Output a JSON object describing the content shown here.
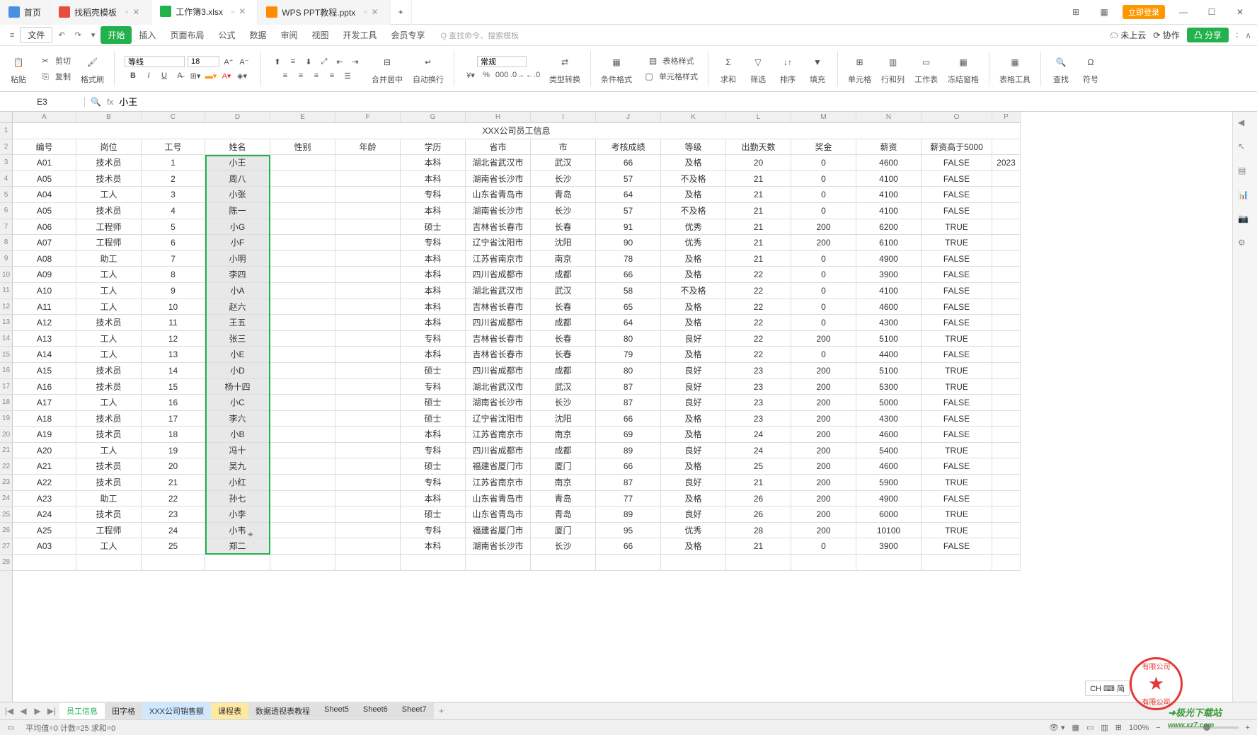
{
  "titlebar": {
    "tabs": [
      {
        "icon": "home",
        "label": "首页",
        "color": "#4a90e2"
      },
      {
        "icon": "doc",
        "label": "找稻壳模板",
        "color": "#e74c3c"
      },
      {
        "icon": "xls",
        "label": "工作簿3.xlsx",
        "color": "#22b14c",
        "active": true
      },
      {
        "icon": "ppt",
        "label": "WPS PPT教程.pptx",
        "color": "#ff8c00"
      }
    ],
    "login": "立即登录",
    "winbtns": [
      "—",
      "☐",
      "✕"
    ]
  },
  "menubar": {
    "file": "文件",
    "items": [
      "开始",
      "插入",
      "页面布局",
      "公式",
      "数据",
      "审阅",
      "视图",
      "开发工具",
      "会员专享"
    ],
    "activeIdx": 0,
    "search": "Q 查找命令、搜索模板",
    "cloud": [
      "未上云",
      "协作"
    ],
    "share": "分享"
  },
  "ribbon": {
    "paste": "粘贴",
    "cut": "剪切",
    "copy": "复制",
    "fmtpaint": "格式刷",
    "font": "等线",
    "size": "18",
    "merge": "合并居中",
    "wrap": "自动换行",
    "numfmt": "常规",
    "typefmt": "类型转换",
    "condfmt": "条件格式",
    "tablestyle": "表格样式",
    "cellstyle": "单元格样式",
    "sum": "求和",
    "filter": "筛选",
    "sort": "排序",
    "fill": "填充",
    "cells": "单元格",
    "rowcol": "行和列",
    "sheet": "工作表",
    "freeze": "冻结窗格",
    "tabletool": "表格工具",
    "find": "查找",
    "symbol": "符号"
  },
  "formulabar": {
    "namebox": "E3",
    "fx": "fx",
    "value": "小王"
  },
  "grid": {
    "cols": [
      "A",
      "B",
      "C",
      "D",
      "E",
      "F",
      "G",
      "H",
      "I",
      "J",
      "K",
      "L",
      "M",
      "N",
      "O",
      "P"
    ],
    "title": "XXX公司员工信息",
    "headers": [
      "编号",
      "岗位",
      "工号",
      "姓名",
      "性别",
      "年龄",
      "学历",
      "省市",
      "市",
      "考核成绩",
      "等级",
      "出勤天数",
      "奖金",
      "薪资",
      "薪资高于5000",
      ""
    ],
    "lastcol": "2023",
    "rows": [
      [
        "A01",
        "技术员",
        "1",
        "小王",
        "",
        "",
        "本科",
        "湖北省武汉市",
        "武汉",
        "66",
        "及格",
        "20",
        "0",
        "4600",
        "FALSE"
      ],
      [
        "A05",
        "技术员",
        "2",
        "周八",
        "",
        "",
        "本科",
        "湖南省长沙市",
        "长沙",
        "57",
        "不及格",
        "21",
        "0",
        "4100",
        "FALSE"
      ],
      [
        "A04",
        "工人",
        "3",
        "小张",
        "",
        "",
        "专科",
        "山东省青岛市",
        "青岛",
        "64",
        "及格",
        "21",
        "0",
        "4100",
        "FALSE"
      ],
      [
        "A05",
        "技术员",
        "4",
        "陈一",
        "",
        "",
        "本科",
        "湖南省长沙市",
        "长沙",
        "57",
        "不及格",
        "21",
        "0",
        "4100",
        "FALSE"
      ],
      [
        "A06",
        "工程师",
        "5",
        "小G",
        "",
        "",
        "硕士",
        "吉林省长春市",
        "长春",
        "91",
        "优秀",
        "21",
        "200",
        "6200",
        "TRUE"
      ],
      [
        "A07",
        "工程师",
        "6",
        "小F",
        "",
        "",
        "专科",
        "辽宁省沈阳市",
        "沈阳",
        "90",
        "优秀",
        "21",
        "200",
        "6100",
        "TRUE"
      ],
      [
        "A08",
        "助工",
        "7",
        "小明",
        "",
        "",
        "本科",
        "江苏省南京市",
        "南京",
        "78",
        "及格",
        "21",
        "0",
        "4900",
        "FALSE"
      ],
      [
        "A09",
        "工人",
        "8",
        "李四",
        "",
        "",
        "本科",
        "四川省成都市",
        "成都",
        "66",
        "及格",
        "22",
        "0",
        "3900",
        "FALSE"
      ],
      [
        "A10",
        "工人",
        "9",
        "小A",
        "",
        "",
        "本科",
        "湖北省武汉市",
        "武汉",
        "58",
        "不及格",
        "22",
        "0",
        "4100",
        "FALSE"
      ],
      [
        "A11",
        "工人",
        "10",
        "赵六",
        "",
        "",
        "本科",
        "吉林省长春市",
        "长春",
        "65",
        "及格",
        "22",
        "0",
        "4600",
        "FALSE"
      ],
      [
        "A12",
        "技术员",
        "11",
        "王五",
        "",
        "",
        "本科",
        "四川省成都市",
        "成都",
        "64",
        "及格",
        "22",
        "0",
        "4300",
        "FALSE"
      ],
      [
        "A13",
        "工人",
        "12",
        "张三",
        "",
        "",
        "专科",
        "吉林省长春市",
        "长春",
        "80",
        "良好",
        "22",
        "200",
        "5100",
        "TRUE"
      ],
      [
        "A14",
        "工人",
        "13",
        "小E",
        "",
        "",
        "本科",
        "吉林省长春市",
        "长春",
        "79",
        "及格",
        "22",
        "0",
        "4400",
        "FALSE"
      ],
      [
        "A15",
        "技术员",
        "14",
        "小D",
        "",
        "",
        "硕士",
        "四川省成都市",
        "成都",
        "80",
        "良好",
        "23",
        "200",
        "5100",
        "TRUE"
      ],
      [
        "A16",
        "技术员",
        "15",
        "杨十四",
        "",
        "",
        "专科",
        "湖北省武汉市",
        "武汉",
        "87",
        "良好",
        "23",
        "200",
        "5300",
        "TRUE"
      ],
      [
        "A17",
        "工人",
        "16",
        "小C",
        "",
        "",
        "硕士",
        "湖南省长沙市",
        "长沙",
        "87",
        "良好",
        "23",
        "200",
        "5000",
        "FALSE"
      ],
      [
        "A18",
        "技术员",
        "17",
        "李六",
        "",
        "",
        "硕士",
        "辽宁省沈阳市",
        "沈阳",
        "66",
        "及格",
        "23",
        "200",
        "4300",
        "FALSE"
      ],
      [
        "A19",
        "技术员",
        "18",
        "小B",
        "",
        "",
        "本科",
        "江苏省南京市",
        "南京",
        "69",
        "及格",
        "24",
        "200",
        "4600",
        "FALSE"
      ],
      [
        "A20",
        "工人",
        "19",
        "冯十",
        "",
        "",
        "专科",
        "四川省成都市",
        "成都",
        "89",
        "良好",
        "24",
        "200",
        "5400",
        "TRUE"
      ],
      [
        "A21",
        "技术员",
        "20",
        "吴九",
        "",
        "",
        "硕士",
        "福建省厦门市",
        "厦门",
        "66",
        "及格",
        "25",
        "200",
        "4600",
        "FALSE"
      ],
      [
        "A22",
        "技术员",
        "21",
        "小红",
        "",
        "",
        "专科",
        "江苏省南京市",
        "南京",
        "87",
        "良好",
        "21",
        "200",
        "5900",
        "TRUE"
      ],
      [
        "A23",
        "助工",
        "22",
        "孙七",
        "",
        "",
        "本科",
        "山东省青岛市",
        "青岛",
        "77",
        "及格",
        "26",
        "200",
        "4900",
        "FALSE"
      ],
      [
        "A24",
        "技术员",
        "23",
        "小李",
        "",
        "",
        "硕士",
        "山东省青岛市",
        "青岛",
        "89",
        "良好",
        "26",
        "200",
        "6000",
        "TRUE"
      ],
      [
        "A25",
        "工程师",
        "24",
        "小韦",
        "",
        "",
        "专科",
        "福建省厦门市",
        "厦门",
        "95",
        "优秀",
        "28",
        "200",
        "10100",
        "TRUE"
      ],
      [
        "A03",
        "工人",
        "25",
        "郑二",
        "",
        "",
        "本科",
        "湖南省长沙市",
        "长沙",
        "66",
        "及格",
        "21",
        "0",
        "3900",
        "FALSE"
      ]
    ]
  },
  "sheets": {
    "tabs": [
      "员工信息",
      "田字格",
      "XXX公司销售额",
      "课程表",
      "数据透视表教程",
      "Sheet5",
      "Sheet6",
      "Sheet7"
    ],
    "activeIdx": 0
  },
  "statusbar": {
    "stats": "平均值=0  计数=25  求和=0",
    "zoom": "100%",
    "lang": "CH ⌨ 简"
  },
  "watermark": "➜极光下载站\nwww.xz7.com"
}
